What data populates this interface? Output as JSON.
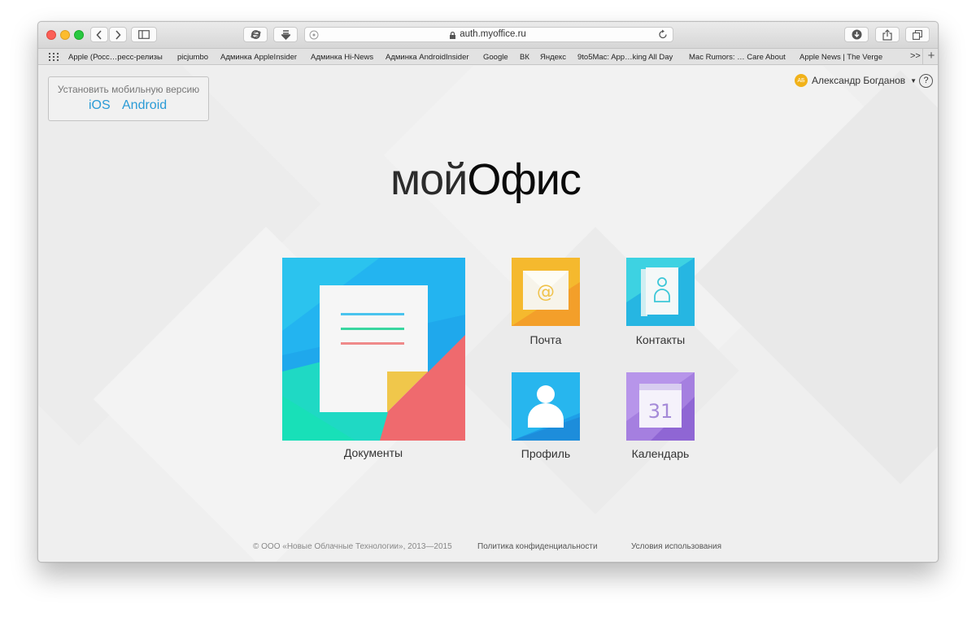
{
  "browser": {
    "url": "auth.myoffice.ru",
    "bookmarks": [
      "Apple (Росс…ресс-релизы",
      "picjumbo",
      "Админка AppleInsider",
      "Админка Hi-News",
      "Админка AndroidInsider",
      "Google",
      "ВК",
      "Яндекс",
      "9to5Mac: App…king All Day",
      "Mac Rumors: … Care About",
      "Apple News | The Verge"
    ],
    "more": ">>",
    "new_tab": "+"
  },
  "mobile": {
    "label": "Установить мобильную версию",
    "ios": "iOS",
    "android": "Android"
  },
  "user": {
    "initials": "АБ",
    "name": "Александр Богданов",
    "help": "?"
  },
  "logo": {
    "thin": "мой",
    "bold": "Офис"
  },
  "apps": {
    "documents": "Документы",
    "mail": "Почта",
    "contacts": "Контакты",
    "profile": "Профиль",
    "calendar": "Календарь",
    "calendar_day": "31",
    "mail_symbol": "@"
  },
  "footer": {
    "copyright": "© ООО «Новые Облачные Технологии», 2013—2015",
    "privacy": "Политика конфиденциальности",
    "terms": "Условия использования"
  }
}
